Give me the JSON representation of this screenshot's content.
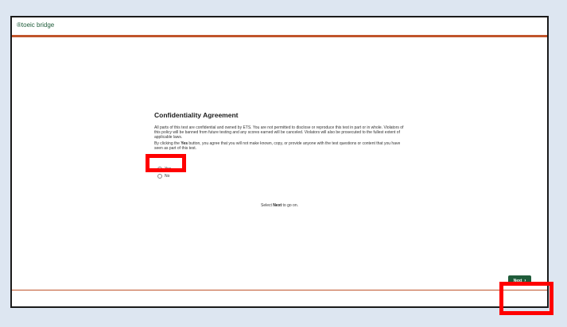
{
  "header": {
    "logo_text": "®toeic bridge"
  },
  "agreement": {
    "title": "Confidentiality Agreement",
    "paragraph1": "All parts of this test are confidential and owned by ETS. You are not permitted to disclose or reproduce this test in part or in whole. Violators of this policy will be banned from future testing and any scores earned will be canceled. Violators will also be prosecuted to the fullest extent of applicable laws.",
    "paragraph2_before": "By clicking the ",
    "paragraph2_bold": "Yes",
    "paragraph2_after": " button, you agree that you will not make known, copy, or provide anyone with the test questions or content that you have seen as part of this test."
  },
  "options": {
    "yes_label": "Yes",
    "no_label": "No"
  },
  "instruction": {
    "before": "Select ",
    "bold": "Next",
    "after": " to go on."
  },
  "footer": {
    "next_label": "Next",
    "next_icon": "chevron-right-icon"
  },
  "colors": {
    "brand_green": "#1f5c3a",
    "accent_orange": "#c0552b",
    "highlight_red": "#ff0000",
    "page_background": "#dde6f1"
  }
}
